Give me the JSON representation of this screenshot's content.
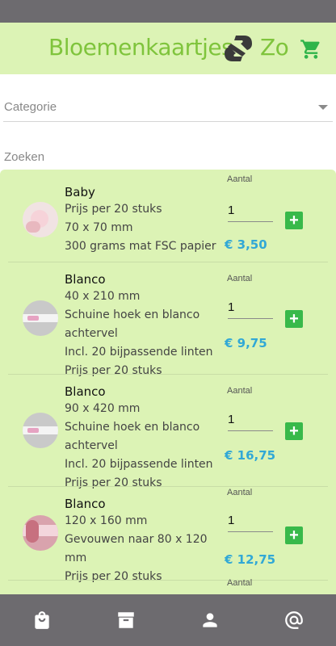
{
  "header": {
    "brand_left": "Bloemenkaartjes",
    "brand_right": "Zo",
    "cart_icon": "shopping-cart-icon",
    "colors": {
      "brand": "#7fc43c",
      "header_bg": "#dcf3b5",
      "price": "#31a8d6",
      "add_button": "#38b94a",
      "chrome": "#6d6b6f"
    }
  },
  "filters": {
    "category_label": "Categorie",
    "search_label": "Zoeken"
  },
  "products": [
    {
      "title": "Baby",
      "lines": [
        "Prijs per 20 stuks",
        "70 x 70 mm",
        "300 grams mat FSC papier"
      ],
      "qty_label": "Aantal",
      "qty": "1",
      "price": "€ 3,50"
    },
    {
      "title": "Blanco",
      "lines": [
        "40 x 210 mm",
        "Schuine hoek en blanco",
        "achtervel",
        "Incl. 20 bijpassende linten",
        "Prijs per 20 stuks"
      ],
      "qty_label": "Aantal",
      "qty": "1",
      "price": "€ 9,75"
    },
    {
      "title": "Blanco",
      "lines": [
        "90 x 420 mm",
        "Schuine hoek en blanco",
        "achtervel",
        "Incl. 20 bijpassende linten",
        "Prijs per 20 stuks"
      ],
      "qty_label": "Aantal",
      "qty": "1",
      "price": "€ 16,75"
    },
    {
      "title": "Blanco",
      "lines": [
        "120 x 160 mm",
        "Gevouwen naar 80 x 120",
        "mm",
        "Prijs per 20 stuks"
      ],
      "qty_label": "Aantal",
      "qty": "1",
      "price": "€ 12,75"
    }
  ],
  "partial_row": {
    "qty_label": "Aantal"
  },
  "bottom_nav": {
    "items": [
      "shopping-bag-icon",
      "archive-icon",
      "person-icon",
      "at-sign-icon"
    ]
  }
}
